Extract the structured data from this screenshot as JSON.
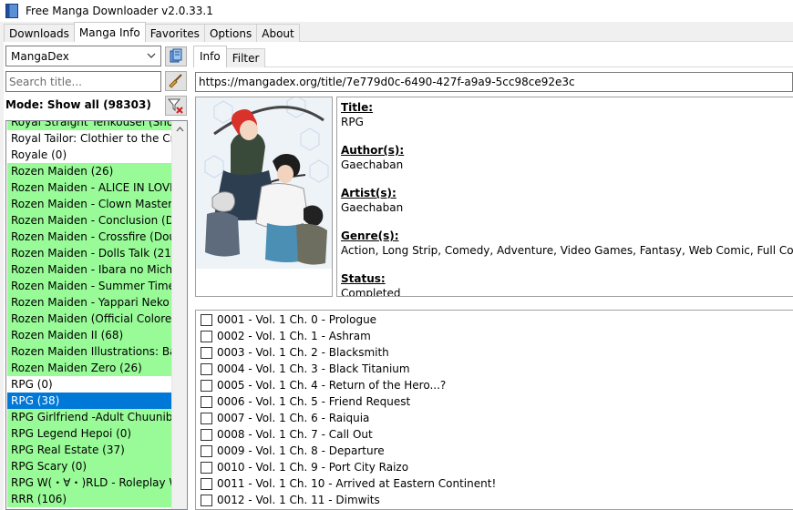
{
  "window": {
    "title": "Free Manga Downloader v2.0.33.1"
  },
  "main_tabs": [
    {
      "label": "Downloads",
      "active": false
    },
    {
      "label": "Manga Info",
      "active": true
    },
    {
      "label": "Favorites",
      "active": false
    },
    {
      "label": "Options",
      "active": false
    },
    {
      "label": "About",
      "active": false
    }
  ],
  "left": {
    "source": "MangaDex",
    "search_placeholder": "Search title...",
    "mode": "Mode: Show all (98303)",
    "manga_list": [
      {
        "title": "Royal Straight Tenkousei (Shotans",
        "status": "green"
      },
      {
        "title": "Royal Tailor: Clothier to the Crown",
        "status": "white"
      },
      {
        "title": "Royale (0)",
        "status": "white"
      },
      {
        "title": "Rozen Maiden (26)",
        "status": "green"
      },
      {
        "title": "Rozen Maiden - ALICE IN LOVE (D",
        "status": "green"
      },
      {
        "title": "Rozen Maiden - Clown Master (Do",
        "status": "green"
      },
      {
        "title": "Rozen Maiden - Conclusion (Douj",
        "status": "green"
      },
      {
        "title": "Rozen Maiden - Crossfire (Doujins",
        "status": "green"
      },
      {
        "title": "Rozen Maiden - Dolls Talk (21)",
        "status": "green"
      },
      {
        "title": "Rozen Maiden - Ibara no Michi  (D",
        "status": "green"
      },
      {
        "title": "Rozen Maiden - Summer Time Blu",
        "status": "green"
      },
      {
        "title": "Rozen Maiden - Yappari Neko ga :",
        "status": "green"
      },
      {
        "title": "Rozen Maiden (Official Colored) (",
        "status": "green"
      },
      {
        "title": "Rozen Maiden II (68)",
        "status": "green"
      },
      {
        "title": "Rozen Maiden Illustrations: Bara G",
        "status": "green"
      },
      {
        "title": "Rozen Maiden Zero (26)",
        "status": "green"
      },
      {
        "title": "RPG (0)",
        "status": "white"
      },
      {
        "title": "RPG (38)",
        "status": "selected"
      },
      {
        "title": "RPG Girlfriend -Adult Chuunibyou",
        "status": "green"
      },
      {
        "title": "RPG Legend Hepoi (0)",
        "status": "green"
      },
      {
        "title": "RPG Real Estate (37)",
        "status": "green"
      },
      {
        "title": "RPG Scary (0)",
        "status": "green"
      },
      {
        "title": "RPG W(・∀・)RLD - Roleplay World",
        "status": "green"
      },
      {
        "title": "RRR (106)",
        "status": "green"
      }
    ]
  },
  "info_tabs": [
    {
      "label": "Info",
      "active": true
    },
    {
      "label": "Filter",
      "active": false
    }
  ],
  "info": {
    "url": "https://mangadex.org/title/7e779d0c-6490-427f-a9a9-5cc98ce92e3c",
    "fields": [
      {
        "label": "Title:",
        "value": "RPG"
      },
      {
        "label": "Author(s):",
        "value": "Gaechaban"
      },
      {
        "label": "Artist(s):",
        "value": "Gaechaban"
      },
      {
        "label": "Genre(s):",
        "value": "Action, Long Strip, Comedy, Adventure, Video Games, Fantasy, Web Comic, Full Color, Safe"
      },
      {
        "label": "Status:",
        "value": "Completed"
      }
    ]
  },
  "chapters": [
    "0001 - Vol. 1 Ch. 0 - Prologue",
    "0002 - Vol. 1 Ch. 1 - Ashram",
    "0003 - Vol. 1 Ch. 2 - Blacksmith",
    "0004 - Vol. 1 Ch. 3 - Black Titanium",
    "0005 - Vol. 1 Ch. 4 - Return of the Hero...?",
    "0006 - Vol. 1 Ch. 5 - Friend Request",
    "0007 - Vol. 1 Ch. 6 - Raiquia",
    "0008 - Vol. 1 Ch. 7 - Call Out",
    "0009 - Vol. 1 Ch. 8 - Departure",
    "0010 - Vol. 1 Ch. 9 - Port City Raizo",
    "0011 - Vol. 1 Ch. 10 - Arrived at Eastern Continent!",
    "0012 - Vol. 1 Ch. 11 - Dimwits"
  ],
  "colors": {
    "downloaded": "#98fb98",
    "selection": "#0078d7"
  }
}
